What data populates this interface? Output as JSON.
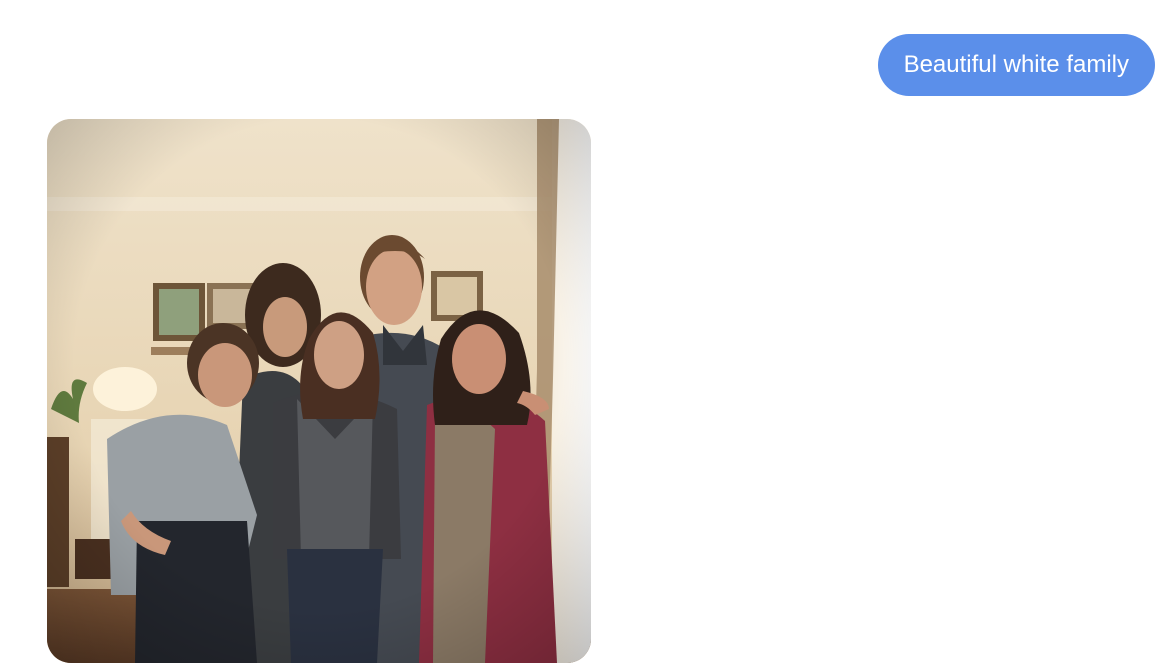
{
  "conversation": {
    "user_message": "Beautiful white family"
  },
  "generated_image": {
    "subject": "family-photo",
    "colors": {
      "wall": "#eadbc2",
      "accent_bubble": "#5b8fea"
    }
  }
}
